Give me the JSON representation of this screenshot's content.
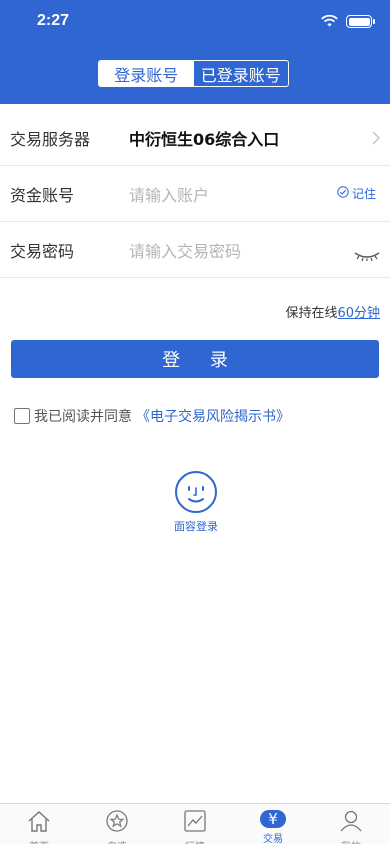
{
  "status_bar": {
    "time": "2:27"
  },
  "header": {
    "segments": [
      {
        "label": "登录账号",
        "active": true
      },
      {
        "label": "已登录账号",
        "active": false
      }
    ]
  },
  "form": {
    "server": {
      "label": "交易服务器",
      "value": "中衍恒生06综合入口"
    },
    "account": {
      "label": "资金账号",
      "placeholder": "请输入账户",
      "remember_label": "记住"
    },
    "password": {
      "label": "交易密码",
      "placeholder": "请输入交易密码"
    }
  },
  "keep_online": {
    "prefix": "保持在线",
    "duration": "60分钟"
  },
  "login_button": "登 录",
  "agreement": {
    "text": "我已阅读并同意",
    "doc": "《电子交易风险揭示书》"
  },
  "face_login": {
    "label": "面容登录"
  },
  "tabbar": {
    "items": [
      {
        "label": "首页",
        "icon": "home-icon"
      },
      {
        "label": "自选",
        "icon": "star-icon"
      },
      {
        "label": "行情",
        "icon": "chart-icon"
      },
      {
        "label": "交易",
        "icon": "yen-icon",
        "active": true
      },
      {
        "label": "我的",
        "icon": "user-icon"
      }
    ]
  },
  "colors": {
    "brand": "#2f66d2",
    "divider": "#e8e8e8",
    "placeholder": "#b5b5b5"
  }
}
